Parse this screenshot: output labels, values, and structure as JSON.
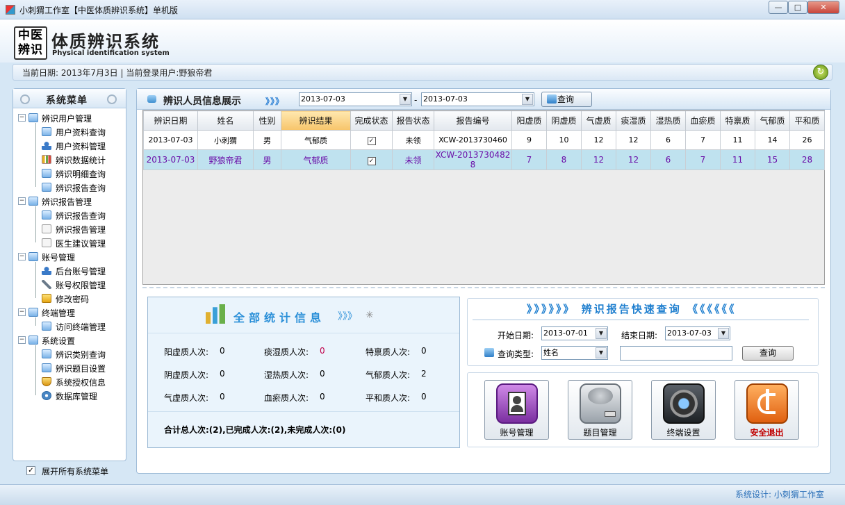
{
  "window": {
    "title": "小刺猬工作室【中医体质辨识系统】单机版",
    "min": "—",
    "max": "□",
    "close": "✕"
  },
  "header": {
    "logo_line1": "中医",
    "logo_line2": "辨识",
    "title": "体质辨识系统",
    "subtitle": "Physical identification system"
  },
  "infobar": {
    "text": "当前日期: 2013年7月3日 | 当前登录用户:野狼帝君"
  },
  "sidebar": {
    "title": "系统菜单",
    "groups": [
      {
        "label": "辨识用户管理",
        "items": [
          "用户资料查询",
          "用户资料管理",
          "辨识数据统计",
          "辨识明细查询",
          "辨识报告查询"
        ]
      },
      {
        "label": "辨识报告管理",
        "items": [
          "辨识报告查询",
          "辨识报告管理",
          "医生建议管理"
        ]
      },
      {
        "label": "账号管理",
        "items": [
          "后台账号管理",
          "账号权限管理",
          "修改密码"
        ]
      },
      {
        "label": "终端管理",
        "items": [
          "访问终端管理"
        ]
      },
      {
        "label": "系统设置",
        "items": [
          "辨识类别查询",
          "辨识题目设置",
          "系统授权信息",
          "数据库管理"
        ]
      }
    ],
    "expand_label": "展开所有系统菜单"
  },
  "main": {
    "title": "辨识人员信息展示",
    "arrows": "》》》",
    "date_from": "2013-07-03",
    "date_dash": "-",
    "date_to": "2013-07-03",
    "query_label": "查询",
    "columns": [
      "辨识日期",
      "姓名",
      "性别",
      "辨识结果",
      "完成状态",
      "报告状态",
      "报告编号",
      "阳虚质",
      "阴虚质",
      "气虚质",
      "痰湿质",
      "湿热质",
      "血瘀质",
      "特禀质",
      "气郁质",
      "平和质"
    ],
    "rows": [
      [
        "2013-07-03",
        "小刺猬",
        "男",
        "气郁质",
        "✓",
        "未领",
        "XCW-2013730460",
        "9",
        "10",
        "12",
        "12",
        "6",
        "7",
        "11",
        "14",
        "26"
      ],
      [
        "2013-07-03",
        "野狼帝君",
        "男",
        "气郁质",
        "✓",
        "未领",
        "XCW-2013730482​8",
        "7",
        "8",
        "12",
        "12",
        "6",
        "7",
        "11",
        "15",
        "28"
      ]
    ]
  },
  "stats": {
    "title": "全部统计信息",
    "arrows": "》》》",
    "items": [
      {
        "label": "阳虚质人次:",
        "value": "0"
      },
      {
        "label": "痰湿质人次:",
        "value": "0"
      },
      {
        "label": "特禀质人次:",
        "value": "0"
      },
      {
        "label": "阴虚质人次:",
        "value": "0"
      },
      {
        "label": "湿热质人次:",
        "value": "0"
      },
      {
        "label": "气郁质人次:",
        "value": "2"
      },
      {
        "label": "气虚质人次:",
        "value": "0"
      },
      {
        "label": "血瘀质人次:",
        "value": "0"
      },
      {
        "label": "平和质人次:",
        "value": "0"
      }
    ],
    "total": "合计总人次:(2),已完成人次:(2),未完成人次:(0)"
  },
  "quick": {
    "title": "》》》》》》 辨识报告快速查询 《《《《《《",
    "start_label": "开始日期:",
    "start_value": "2013-07-01",
    "end_label": "结束日期:",
    "end_value": "2013-07-03",
    "type_label": "查询类型:",
    "type_value": "姓名",
    "query_label": "查询"
  },
  "actions": [
    {
      "label": "账号管理",
      "icon": "contacts-icon"
    },
    {
      "label": "题目管理",
      "icon": "disk-icon"
    },
    {
      "label": "终端设置",
      "icon": "camera-icon"
    },
    {
      "label": "安全退出",
      "icon": "exit-icon"
    }
  ],
  "status": {
    "text": "系统设计: 小刺猬工作室"
  },
  "colors": {
    "accent": "#2a8fd8",
    "selected_row": "#bfe2ef",
    "selected_text": "#6a0ea8",
    "exit_red": "#c00000"
  }
}
